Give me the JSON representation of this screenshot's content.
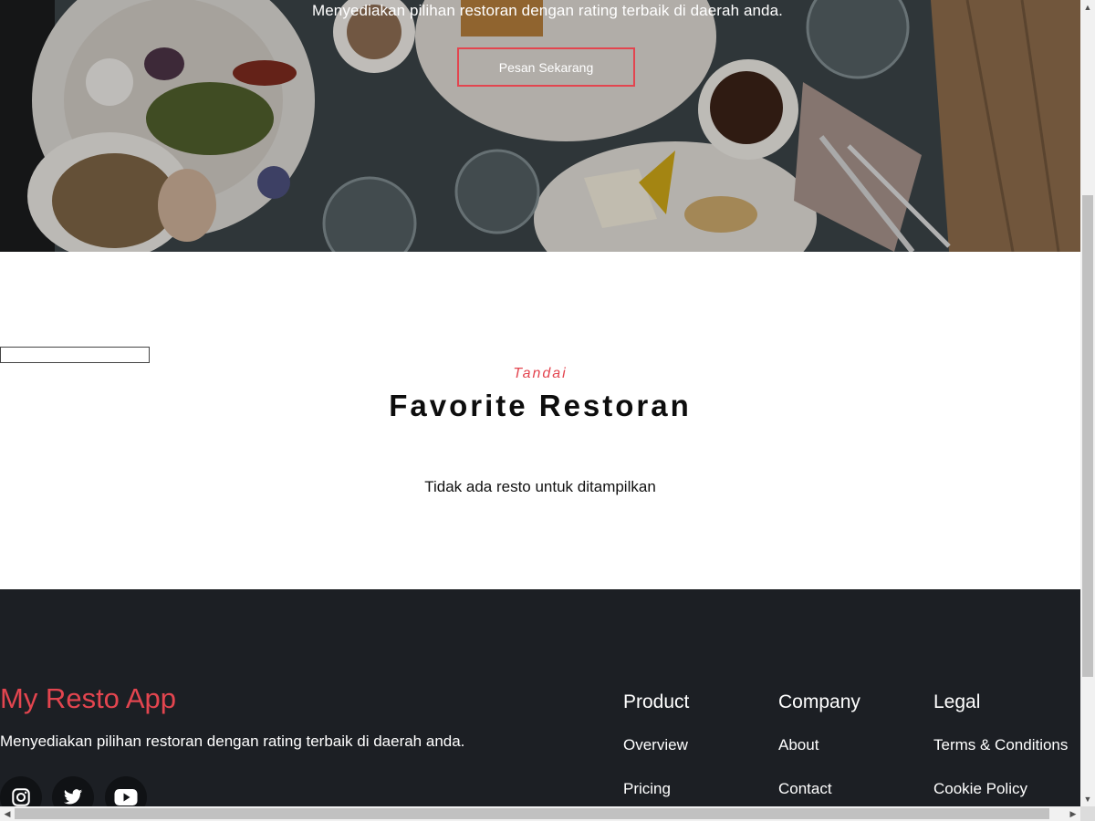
{
  "hero": {
    "tagline": "Menyediakan pilihan restoran dengan rating terbaik di daerah anda.",
    "cta_label": "Pesan Sekarang"
  },
  "favorites": {
    "subtitle": "Tandai",
    "title": "Favorite Restoran",
    "empty_message": "Tidak ada resto untuk ditampilkan"
  },
  "footer": {
    "brand": "My Resto App",
    "description": "Menyediakan pilihan restoran dengan rating terbaik di daerah anda.",
    "socials": [
      "instagram-icon",
      "twitter-icon",
      "youtube-icon"
    ],
    "columns": [
      {
        "title": "Product",
        "links": [
          "Overview",
          "Pricing"
        ]
      },
      {
        "title": "Company",
        "links": [
          "About",
          "Contact"
        ]
      },
      {
        "title": "Legal",
        "links": [
          "Terms & Conditions",
          "Cookie Policy"
        ]
      }
    ]
  },
  "colors": {
    "accent": "#e3454f",
    "footer_bg": "#1c1f24",
    "text_dark": "#0d0d0d"
  }
}
